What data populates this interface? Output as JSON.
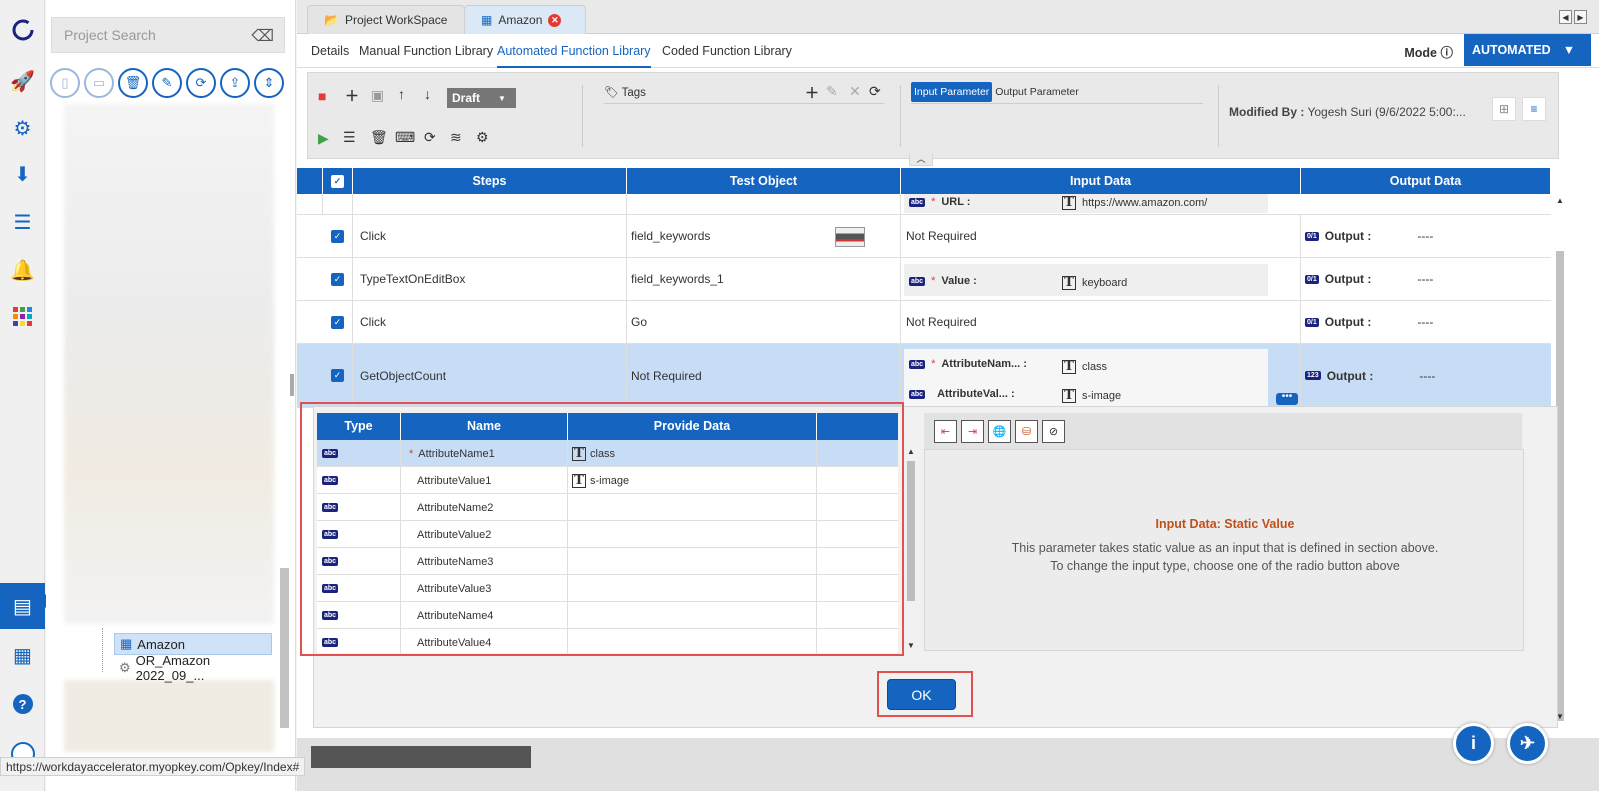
{
  "rail": {
    "icons": [
      "logo-icon",
      "rocket-icon",
      "gears-icon",
      "download-icon",
      "list-icon",
      "bell-icon",
      "apps-grid-icon",
      "presentation-icon",
      "book-icon",
      "help-icon",
      "user-avatar-icon"
    ]
  },
  "project_panel": {
    "search_placeholder": "Project Search",
    "tree": {
      "selected_item": "Amazon",
      "next_item": "OR_Amazon 2022_09_..."
    }
  },
  "tabs": {
    "items": [
      {
        "label": "Project WorkSpace"
      },
      {
        "label": "Amazon"
      }
    ]
  },
  "subtabs": {
    "items": [
      "Details",
      "Manual Function Library",
      "Automated Function Library",
      "Coded Function Library"
    ],
    "active": "Automated Function Library"
  },
  "mode": {
    "label": "Mode",
    "value": "AUTOMATED"
  },
  "toolbar": {
    "status_select": "Draft",
    "tags_label": "Tags",
    "param_tabs": [
      "Input Parameter",
      "Output Parameter"
    ],
    "modified_label": "Modified By :",
    "modified_value": "Yogesh Suri (9/6/2022 5:00:..."
  },
  "grid": {
    "headers": [
      "Steps",
      "Test Object",
      "Input Data",
      "Output Data"
    ],
    "url_row": {
      "label": "URL :",
      "value": "https://www.amazon.com/"
    },
    "rows": [
      {
        "step": "Click",
        "object": "field_keywords",
        "input": "Not Required",
        "output_label": "Output :",
        "output_value": "----",
        "output_type": "0/1"
      },
      {
        "step": "TypeTextOnEditBox",
        "object": "field_keywords_1",
        "input_label": "Value :",
        "input_value": "keyboard",
        "output_label": "Output :",
        "output_value": "----",
        "output_type": "0/1"
      },
      {
        "step": "Click",
        "object": "Go",
        "input": "Not Required",
        "output_label": "Output :",
        "output_value": "----",
        "output_type": "0/1"
      },
      {
        "step": "GetObjectCount",
        "object": "Not Required",
        "input_label_1": "AttributeNam... :",
        "input_value_1": "class",
        "input_label_2": "AttributeVal... :",
        "input_value_2": "s-image",
        "output_label": "Output :",
        "output_value": "----",
        "output_type": "123"
      }
    ]
  },
  "popup": {
    "headers": [
      "Type",
      "Name",
      "Provide Data"
    ],
    "rows": [
      {
        "type": "abc",
        "name": "AttributeName1",
        "required": "*",
        "data": "class"
      },
      {
        "type": "abc",
        "name": "AttributeValue1",
        "data": "s-image"
      },
      {
        "type": "abc",
        "name": "AttributeName2",
        "data": ""
      },
      {
        "type": "abc",
        "name": "AttributeValue2",
        "data": ""
      },
      {
        "type": "abc",
        "name": "AttributeName3",
        "data": ""
      },
      {
        "type": "abc",
        "name": "AttributeValue3",
        "data": ""
      },
      {
        "type": "abc",
        "name": "AttributeName4",
        "data": ""
      },
      {
        "type": "abc",
        "name": "AttributeValue4",
        "data": ""
      }
    ],
    "info_title": "Input Data: Static Value",
    "info_line1": "This parameter takes static value as an input that is defined in section above.",
    "info_line2": "To change the input type, choose one of the radio button above",
    "ok_label": "OK"
  },
  "status_url": "https://workdayaccelerator.myopkey.com/Opkey/Index#"
}
